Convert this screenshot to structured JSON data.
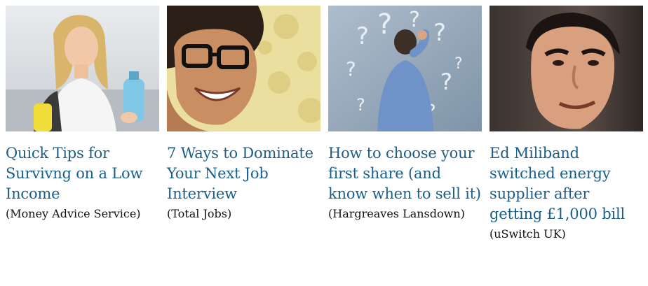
{
  "cards": [
    {
      "headline": "Quick Tips for Survivng on a Low Income",
      "source": "(Money Advice Service)",
      "image_icon": "woman-shopping-image"
    },
    {
      "headline": "7 Ways to Dominate Your Next Job Interview",
      "source": "(Total Jobs)",
      "image_icon": "smiling-woman-glasses-image"
    },
    {
      "headline": "How to choose your first share (and know when to sell it)",
      "source": "(Hargreaves Lansdown)",
      "image_icon": "man-question-marks-image"
    },
    {
      "headline": "Ed Miliband switched energy supplier after getting £1,000 bill",
      "source": "(uSwitch UK)",
      "image_icon": "man-portrait-image"
    }
  ],
  "colors": {
    "headline": "#1a5e8a",
    "source": "#111111"
  }
}
